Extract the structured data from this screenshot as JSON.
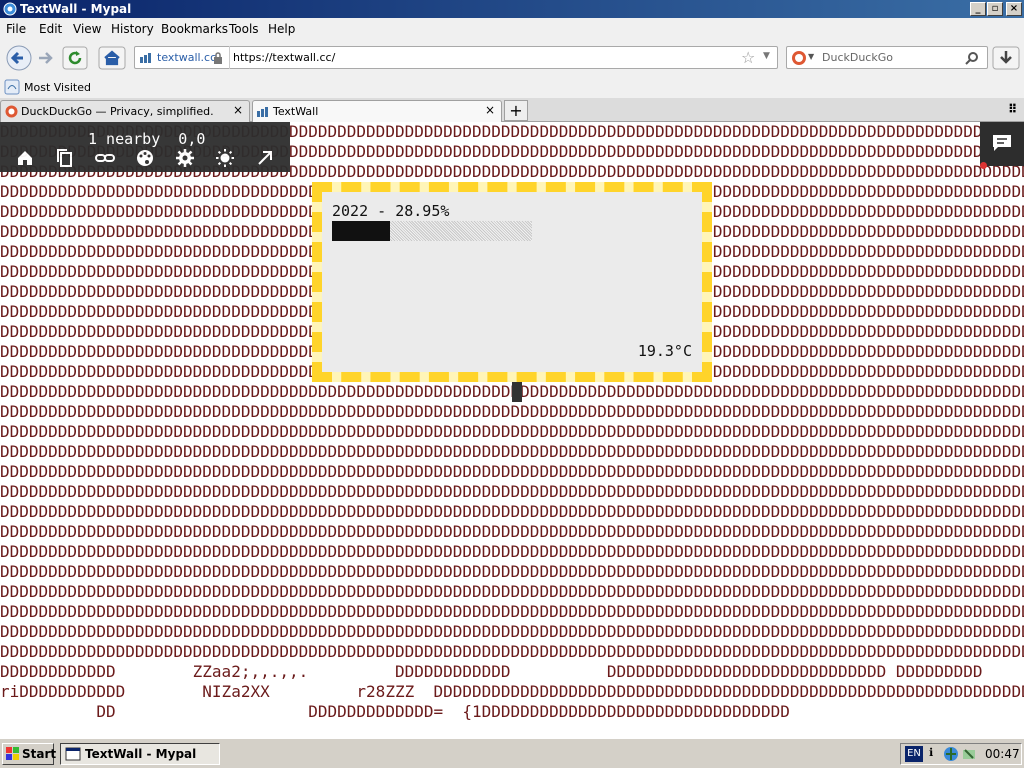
{
  "window": {
    "title": "TextWall - Mypal"
  },
  "menu": [
    "File",
    "Edit",
    "View",
    "History",
    "Bookmarks",
    "Tools",
    "Help"
  ],
  "urlbar": {
    "site_label": "textwall.cc",
    "url": "https://textwall.cc/"
  },
  "searchbar": {
    "engine": "DuckDuckGo"
  },
  "bookmarks": {
    "most_visited": "Most Visited"
  },
  "tabs": [
    {
      "title": "DuckDuckGo — Privacy, simplified.",
      "active": false
    },
    {
      "title": "TextWall",
      "active": true
    }
  ],
  "toolbar": {
    "info": "1 nearby  0,0",
    "icons": [
      "home-icon",
      "copy-icon",
      "link-icon",
      "palette-icon",
      "settings-icon",
      "brightness-icon",
      "expand-icon"
    ]
  },
  "popup": {
    "year_text": "2022 - 28.95%",
    "progress": 0.2895,
    "temperature": "19.3°C"
  },
  "wall": {
    "rows_full": 27,
    "bottom_rows": [
      "DDDDDDDDDDDD        ZZaa2;,,.,,.         DDDDDDDDDDDD          DDDDDDDDDDDDDDDDDDDDDDDDDDDDD DDDDDDDDD",
      "riDDDDDDDDDDD        NIZa2XX         r28ZZZ  DDDDDDDDDDDDDDDDDDDDDDDDDDDDDDDDDDDDDDDDDDDDDDDDDDDDDDDDDDDDDDDDDD",
      "          DD                    DDDDDDDDDDDDD=  {1DDDDDDDDDDDDDDDDDDDDDDDDDDDDDDDD"
    ]
  },
  "taskbar": {
    "start": "Start",
    "item": "TextWall - Mypal",
    "lang": "EN",
    "clock": "00:47"
  },
  "colors": {
    "title_gradient_start": "#0a246a",
    "popup_frame": "#ffd42a",
    "text_color": "#6b1a1a"
  }
}
